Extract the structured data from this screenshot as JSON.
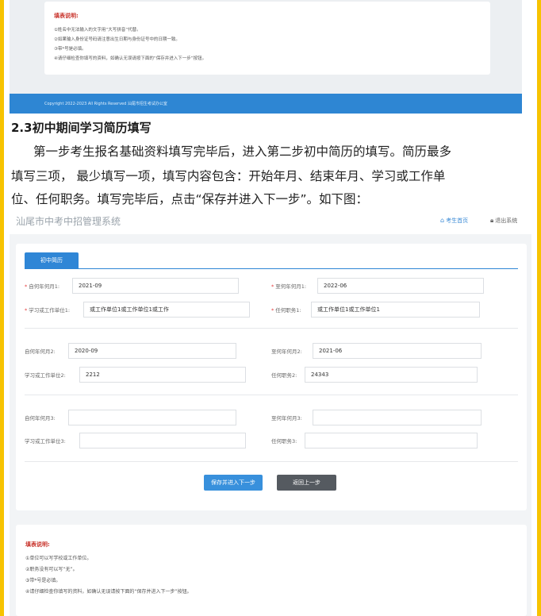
{
  "top_screenshot": {
    "note_title": "填表说明:",
    "note_lines": [
      "①姓名中无法输入的文字用“大写拼音”代替。",
      "②如果输入身份证号码请注意出生日期与身份证号中的日期一致。",
      "③带*号是必填。",
      "④请仔细检查你填写的资料，如确认无误请按下面的“保存并进入下一步”按钮。"
    ],
    "footer": "Copyright 2022-2023 All Rights Reserved 汕尾市招生考试办公室"
  },
  "article": {
    "heading": "2.3初中期间学习简历填写",
    "paragraph_lines": [
      "第一步考生报名基础资料填写完毕后，进入第二步初中简历的填写。简历最多",
      "填写三项， 最少填写一项，填写内容包含：开始年月、结束年月、学习或工作单",
      "位、任何职务。填写完毕后，点击“保存并进入下一步”。如下图："
    ]
  },
  "system": {
    "title": "汕尾市中考中招管理系统",
    "nav_home": "考生首页",
    "nav_exit": "退出系统",
    "tab": "初中简历",
    "required_mark": "*",
    "entries": [
      {
        "start_label": "自何年何月1:",
        "start_value": "2021-09",
        "end_label": "至何年何月1:",
        "end_value": "2022-06",
        "unit_label": "学习或工作单位1:",
        "unit_value": "或工作单位1或工作单位1或工作",
        "post_label": "任何职务1:",
        "post_value": "或工作单位1或工作单位1"
      },
      {
        "start_label": "自何年何月2:",
        "start_value": "2020-09",
        "end_label": "至何年何月2:",
        "end_value": "2021-06",
        "unit_label": "学习或工作单位2:",
        "unit_value": "2212",
        "post_label": "任何职务2:",
        "post_value": "24343"
      },
      {
        "start_label": "自何年何月3:",
        "start_value": "",
        "end_label": "至何年何月3:",
        "end_value": "",
        "unit_label": "学习或工作单位3:",
        "unit_value": "",
        "post_label": "任何职务3:",
        "post_value": ""
      }
    ],
    "save_button": "保存并进入下一步",
    "back_button": "返回上一步",
    "note_title": "填表说明:",
    "note_lines": [
      "①单位可以写学校或工作单位。",
      "②职务没有可以写“无”。",
      "③带*号是必填。",
      "④请仔细检查你填写的资料，如确认无误请按下面的“保存并进入下一步”按钮。"
    ]
  },
  "colors": {
    "accent_blue": "#2f86d6",
    "dark_button": "#555a60",
    "required_red": "#e43b3b",
    "page_border": "#f7c300"
  }
}
